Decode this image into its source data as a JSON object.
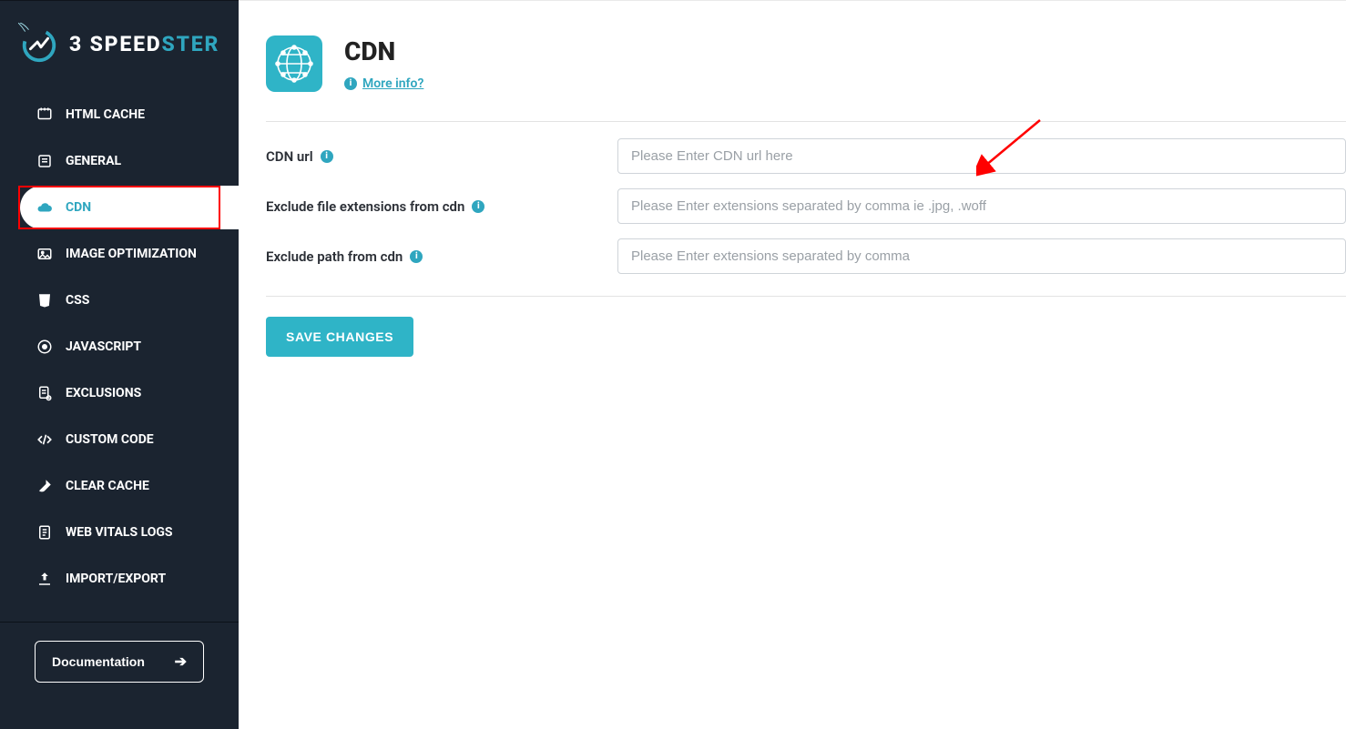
{
  "brand": {
    "part1": "3 SPEED",
    "part2": "STER"
  },
  "sidebar": {
    "items": [
      {
        "label": "HTML CACHE",
        "icon": "html-cache-icon",
        "active": false
      },
      {
        "label": "GENERAL",
        "icon": "general-icon",
        "active": false
      },
      {
        "label": "CDN",
        "icon": "cloud-icon",
        "active": true
      },
      {
        "label": "IMAGE OPTIMIZATION",
        "icon": "image-icon",
        "active": false
      },
      {
        "label": "CSS",
        "icon": "css-icon",
        "active": false
      },
      {
        "label": "JAVASCRIPT",
        "icon": "js-icon",
        "active": false
      },
      {
        "label": "EXCLUSIONS",
        "icon": "exclusions-icon",
        "active": false
      },
      {
        "label": "CUSTOM CODE",
        "icon": "code-icon",
        "active": false
      },
      {
        "label": "CLEAR CACHE",
        "icon": "brush-icon",
        "active": false
      },
      {
        "label": "WEB VITALS LOGS",
        "icon": "logs-icon",
        "active": false
      },
      {
        "label": "IMPORT/EXPORT",
        "icon": "upload-icon",
        "active": false
      }
    ],
    "documentation_label": "Documentation"
  },
  "page": {
    "title": "CDN",
    "more_info_label": "More info?"
  },
  "form": {
    "fields": [
      {
        "label": "CDN url",
        "placeholder": "Please Enter CDN url here",
        "value": ""
      },
      {
        "label": "Exclude file extensions from cdn",
        "placeholder": "Please Enter extensions separated by comma ie .jpg, .woff",
        "value": ""
      },
      {
        "label": "Exclude path from cdn",
        "placeholder": "Please Enter extensions separated by comma",
        "value": ""
      }
    ],
    "save_label": "SAVE CHANGES"
  },
  "colors": {
    "accent": "#2fa6bf",
    "sidebar": "#1b2430",
    "highlight": "#ff0000"
  }
}
